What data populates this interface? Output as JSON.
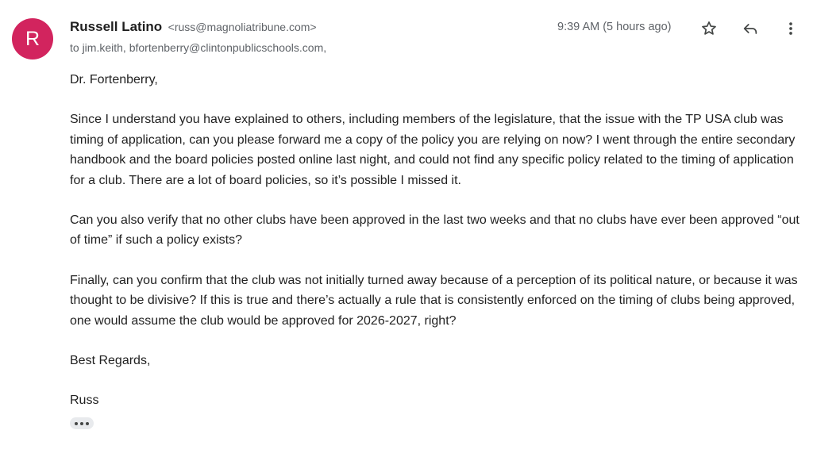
{
  "email": {
    "avatar_letter": "R",
    "avatar_color": "#d2245e",
    "sender_name": "Russell Latino",
    "sender_email": "<russ@magnoliatribune.com>",
    "recipients": "to jim.keith, bfortenberry@clintonpublicschools.com,",
    "timestamp": "9:39 AM (5 hours ago)",
    "actions": {
      "star_icon": "star-icon",
      "reply_icon": "reply-icon",
      "more_icon": "more-vert-icon"
    },
    "body": {
      "greeting": "Dr. Fortenberry,",
      "paragraph_1": "Since I understand you have explained to others, including members of the legislature, that the issue with the TP USA club was timing of application, can you please forward me a copy of the policy you are relying on now? I went through the entire secondary handbook and the board policies posted online last night, and could not find any specific policy related to the timing of application for a club. There are a lot of board policies, so it’s possible I missed it.",
      "paragraph_2": "Can you also verify that no other clubs have been approved in the last two weeks and that no clubs have ever been approved “out of time” if such a policy exists?",
      "paragraph_3": "Finally, can you confirm that the club was not initially turned away because of a perception of its political nature, or because it was thought to be divisive? If this is true and there’s actually a rule that is consistently enforced on the timing of clubs being approved, one would assume the club would be approved for 2026-2027, right?",
      "closing": "Best Regards,",
      "signature": "Russ"
    },
    "expand_icon": "ellipsis-icon"
  }
}
